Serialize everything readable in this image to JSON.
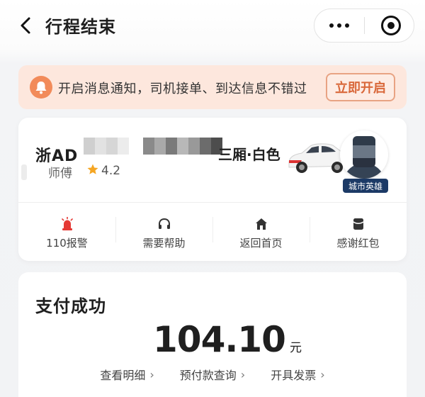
{
  "header": {
    "title": "行程结束",
    "back_icon": "back-arrow-icon",
    "menu_icon": "more-dots-icon",
    "close_icon": "target-circle-icon"
  },
  "notice": {
    "text": "开启消息通知，司机接单、到达信息不错过",
    "button_label": "立即开启",
    "icon": "bell-icon",
    "accent": "#f28b5a"
  },
  "driver": {
    "plate_prefix": "浙AD",
    "car_description": "三厢·白色",
    "name": "师傅",
    "rating": "4.2",
    "badge": "城市英雄",
    "badge_color": "#1c3a66"
  },
  "actions": [
    {
      "label": "110报警",
      "icon": "alarm-icon"
    },
    {
      "label": "需要帮助",
      "icon": "headset-icon"
    },
    {
      "label": "返回首页",
      "icon": "home-icon"
    },
    {
      "label": "感谢红包",
      "icon": "red-packet-icon"
    }
  ],
  "payment": {
    "title": "支付成功",
    "amount": "104.10",
    "unit": "元",
    "links": [
      {
        "label": "查看明细",
        "chevron": "›"
      },
      {
        "label": "预付款查询",
        "chevron": "›"
      },
      {
        "label": "开具发票",
        "chevron": "›"
      }
    ]
  }
}
